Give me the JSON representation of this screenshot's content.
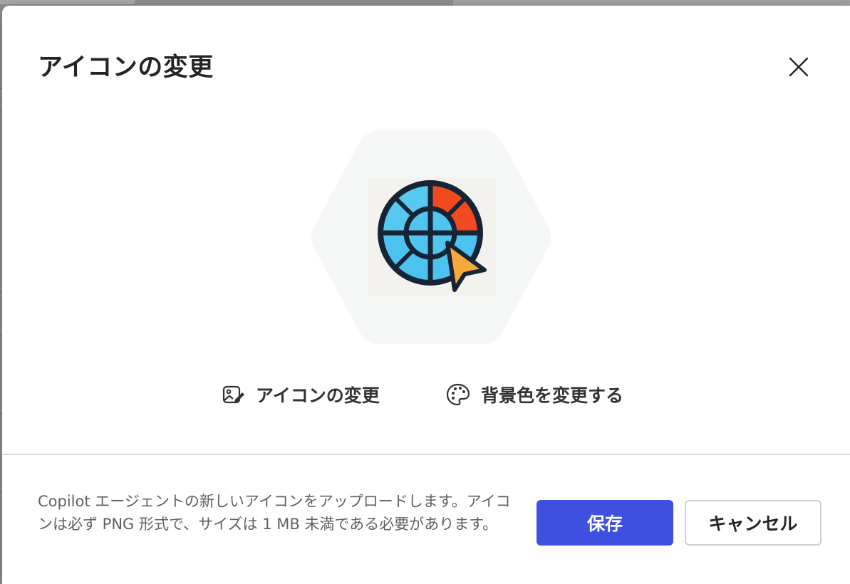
{
  "dialog": {
    "title": "アイコンの変更",
    "close_icon": "close-icon"
  },
  "preview": {
    "icon_description_name": "color-wheel-cursor-icon"
  },
  "actions": {
    "change_icon_label": "アイコンの変更",
    "change_icon_icon": "image-edit-icon",
    "bg_color_label": "背景色を変更する",
    "bg_color_icon": "palette-icon"
  },
  "footer": {
    "description": "Copilot エージェントの新しいアイコンをアップロードします。アイコンは必ず PNG 形式で、サイズは 1 MB 未満である必要があります。",
    "save_label": "保存",
    "cancel_label": "キャンセル"
  },
  "colors": {
    "primary": "#3f4fe0",
    "wheel_blue": "#4cc3ee",
    "wheel_red": "#f04a1e",
    "cursor_orange": "#f6a93b",
    "outline": "#162436"
  }
}
